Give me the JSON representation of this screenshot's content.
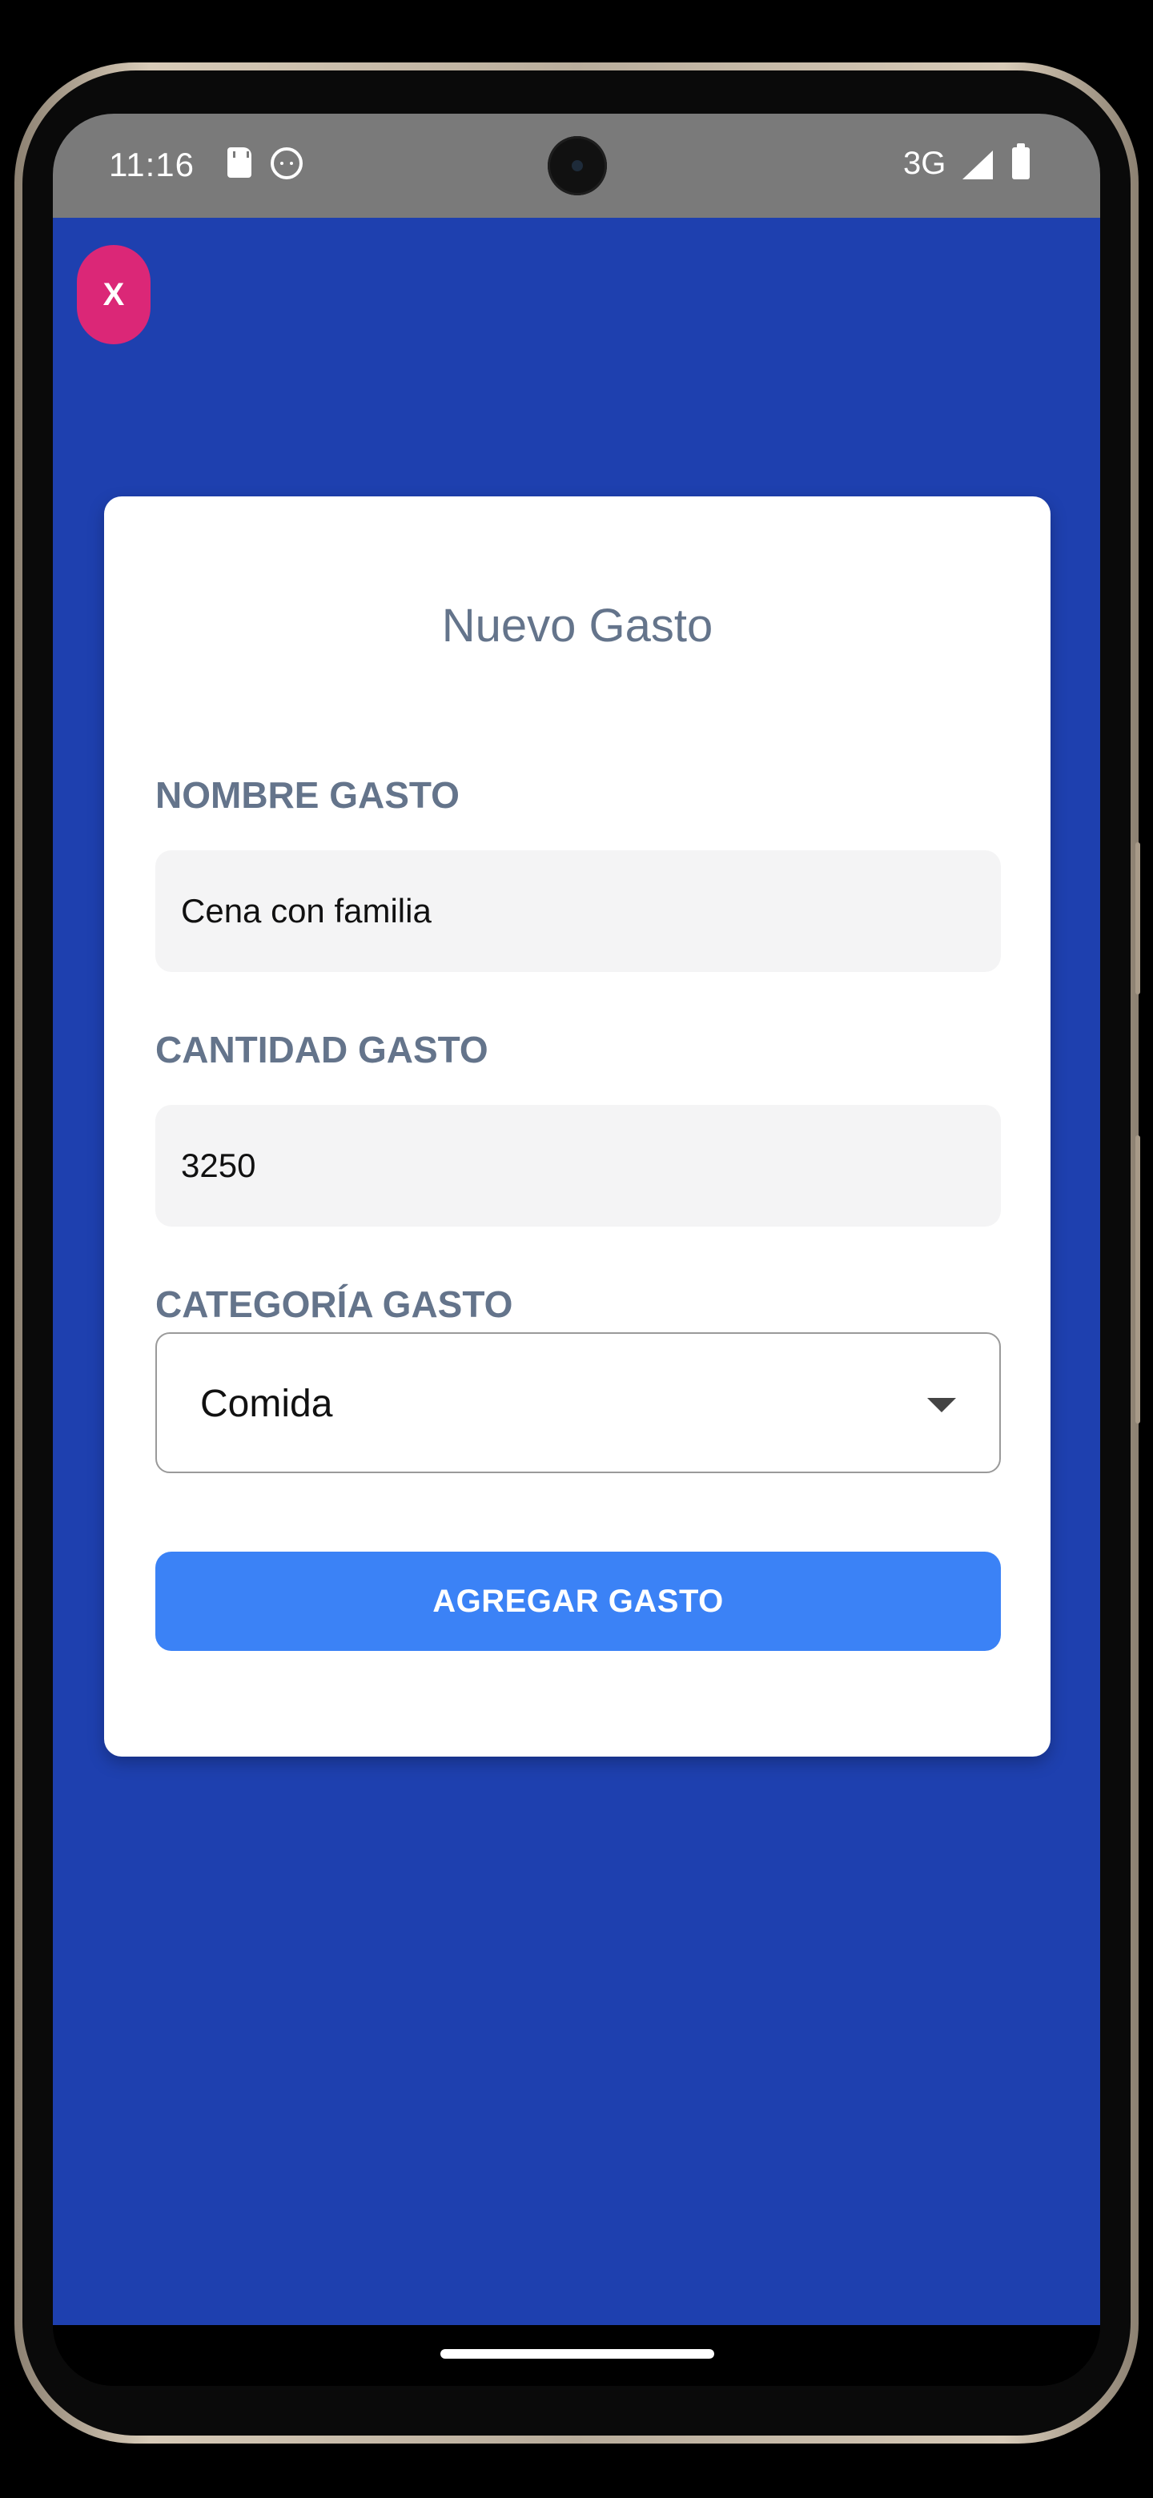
{
  "status_bar": {
    "time": "11:16",
    "network": "3G",
    "icons": [
      "sd-card-icon",
      "face-icon",
      "signal-icon",
      "battery-icon"
    ]
  },
  "colors": {
    "app_background": "#1e40af",
    "close_button": "#db2777",
    "primary_button": "#3b82f6",
    "label_text": "#64748b",
    "input_background": "#f4f4f5"
  },
  "header": {
    "close_label": "X"
  },
  "form": {
    "title": "Nuevo Gasto",
    "name_label": "NOMBRE GASTO",
    "name_value": "Cena con familia",
    "amount_label": "CANTIDAD GASTO",
    "amount_value": "3250",
    "category_label": "CATEGORÍA GASTO",
    "category_value": "Comida",
    "submit_label": "AGREGAR GASTO"
  }
}
